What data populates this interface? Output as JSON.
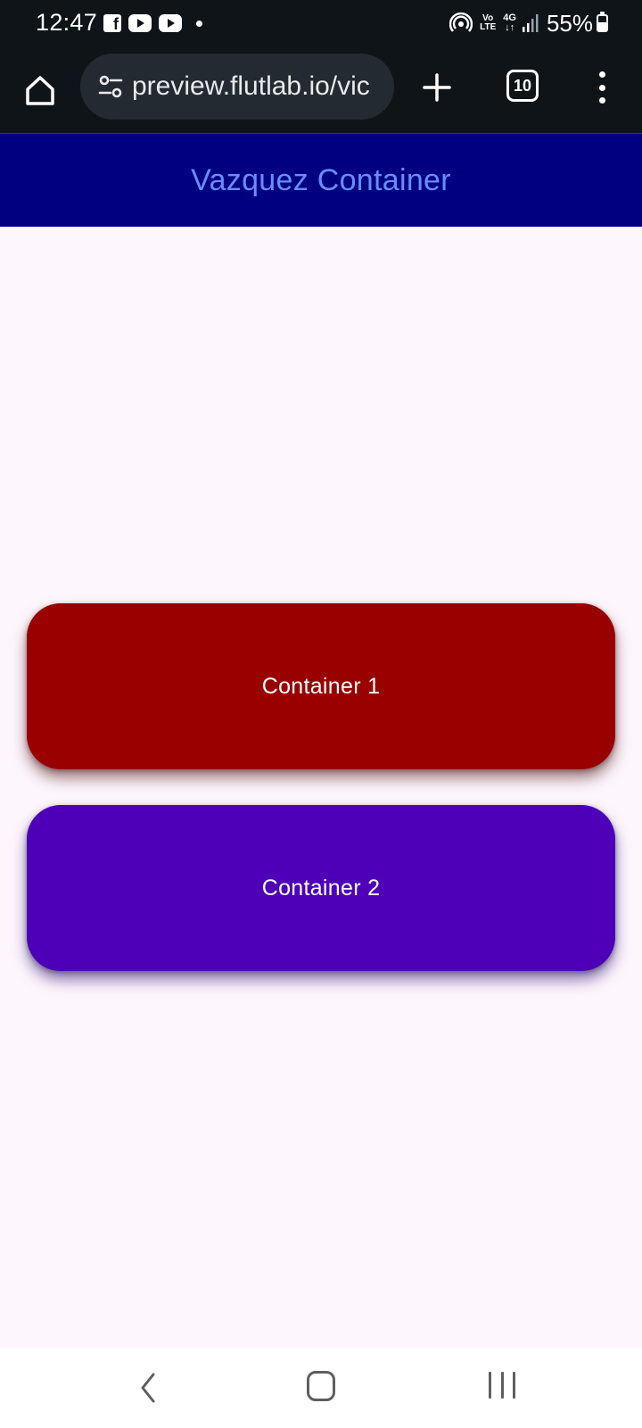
{
  "status_bar": {
    "time": "12:47",
    "left_icons": [
      "facebook-icon",
      "youtube-icon",
      "youtube-icon",
      "notification-dot-icon"
    ],
    "volte_line1": "Vo",
    "volte_line2": "LTE",
    "network_type": "4G",
    "battery_percent": "55%",
    "battery_level": 0.55
  },
  "browser": {
    "url": "preview.flutlab.io/vic",
    "tab_count": "10",
    "icons": {
      "home": "home-icon",
      "site_info": "site-info-icon",
      "new_tab": "plus-icon",
      "tabs": "tab-switcher-icon",
      "menu": "more-vertical-icon"
    }
  },
  "app": {
    "title": "Vazquez Container",
    "colors": {
      "app_bar_background": "#000080",
      "title_color": "#6b8bff",
      "page_background": "#fdf6fd"
    }
  },
  "containers": [
    {
      "label": "Container 1",
      "color": "#990000"
    },
    {
      "label": "Container 2",
      "color": "#4d00b8"
    }
  ],
  "nav_bar": {
    "icons": [
      "back-icon",
      "home-icon",
      "recents-icon"
    ]
  }
}
